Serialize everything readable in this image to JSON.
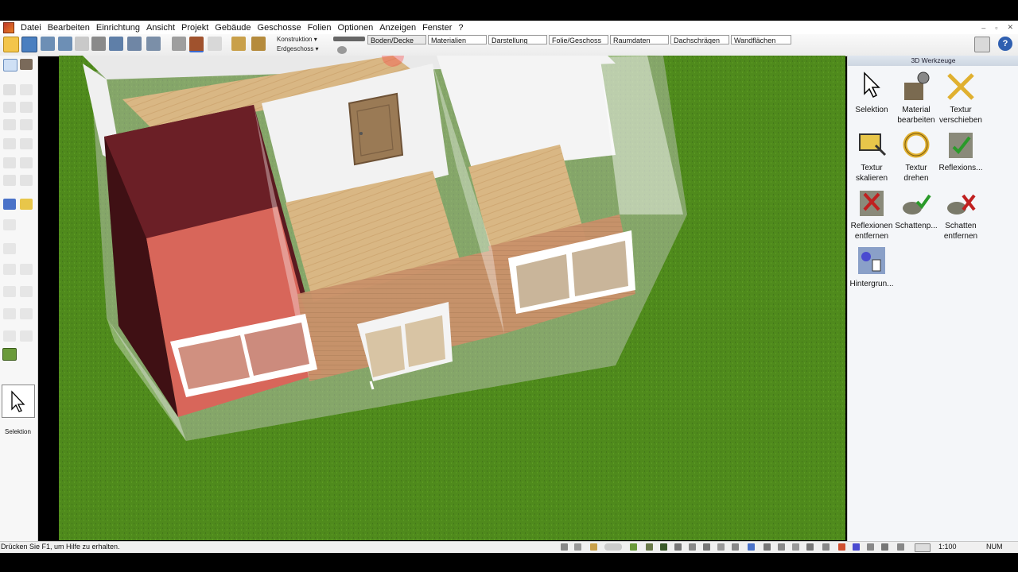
{
  "menu": [
    "Datei",
    "Bearbeiten",
    "Einrichtung",
    "Ansicht",
    "Projekt",
    "Gebäude",
    "Geschosse",
    "Folien",
    "Optionen",
    "Anzeigen",
    "Fenster",
    "?"
  ],
  "window_controls": [
    "–",
    "▫",
    "✕"
  ],
  "toolbar": {
    "dropdown_construction": "Konstruktion",
    "dropdown_floor": "Erdgeschoss",
    "tabs": [
      "Boden/Decke",
      "Materialien",
      "Darstellung",
      "Folie/Geschoss",
      "Raumdaten",
      "Dachschrägen",
      "Wandflächen"
    ],
    "active_tab": "Boden/Decke"
  },
  "left_palette": {
    "selected_tool_label": "Selektion"
  },
  "right_panel": {
    "title": "3D Werkzeuge",
    "tools": [
      {
        "line1": "Selektion",
        "line2": "",
        "icon": "cursor-icon"
      },
      {
        "line1": "Material",
        "line2": "bearbeiten",
        "icon": "material-edit-icon"
      },
      {
        "line1": "Textur",
        "line2": "verschieben",
        "icon": "texture-move-icon"
      },
      {
        "line1": "Textur",
        "line2": "skalieren",
        "icon": "texture-scale-icon"
      },
      {
        "line1": "Textur",
        "line2": "drehen",
        "icon": "texture-rotate-icon"
      },
      {
        "line1": "Reflexions...",
        "line2": "",
        "icon": "reflection-icon"
      },
      {
        "line1": "Reflexionen",
        "line2": "entfernen",
        "icon": "reflection-remove-icon"
      },
      {
        "line1": "Schattenp...",
        "line2": "",
        "icon": "shadow-icon"
      },
      {
        "line1": "Schatten",
        "line2": "entfernen",
        "icon": "shadow-remove-icon"
      },
      {
        "line1": "Hintergrun...",
        "line2": "",
        "icon": "background-icon"
      }
    ]
  },
  "statusbar": {
    "help_text": "Drücken Sie F1, um Hilfe zu erhalten.",
    "scale": "1:100",
    "num": "NUM"
  },
  "colors": {
    "lawn": "#4f8a1c",
    "wall_white": "#f2f2f2",
    "floor_wood": "#d9b784",
    "brick": "#c9916a",
    "dark_red": "#6b1f26",
    "red_floor": "#d8665a",
    "door_wood": "#9a7a55"
  }
}
